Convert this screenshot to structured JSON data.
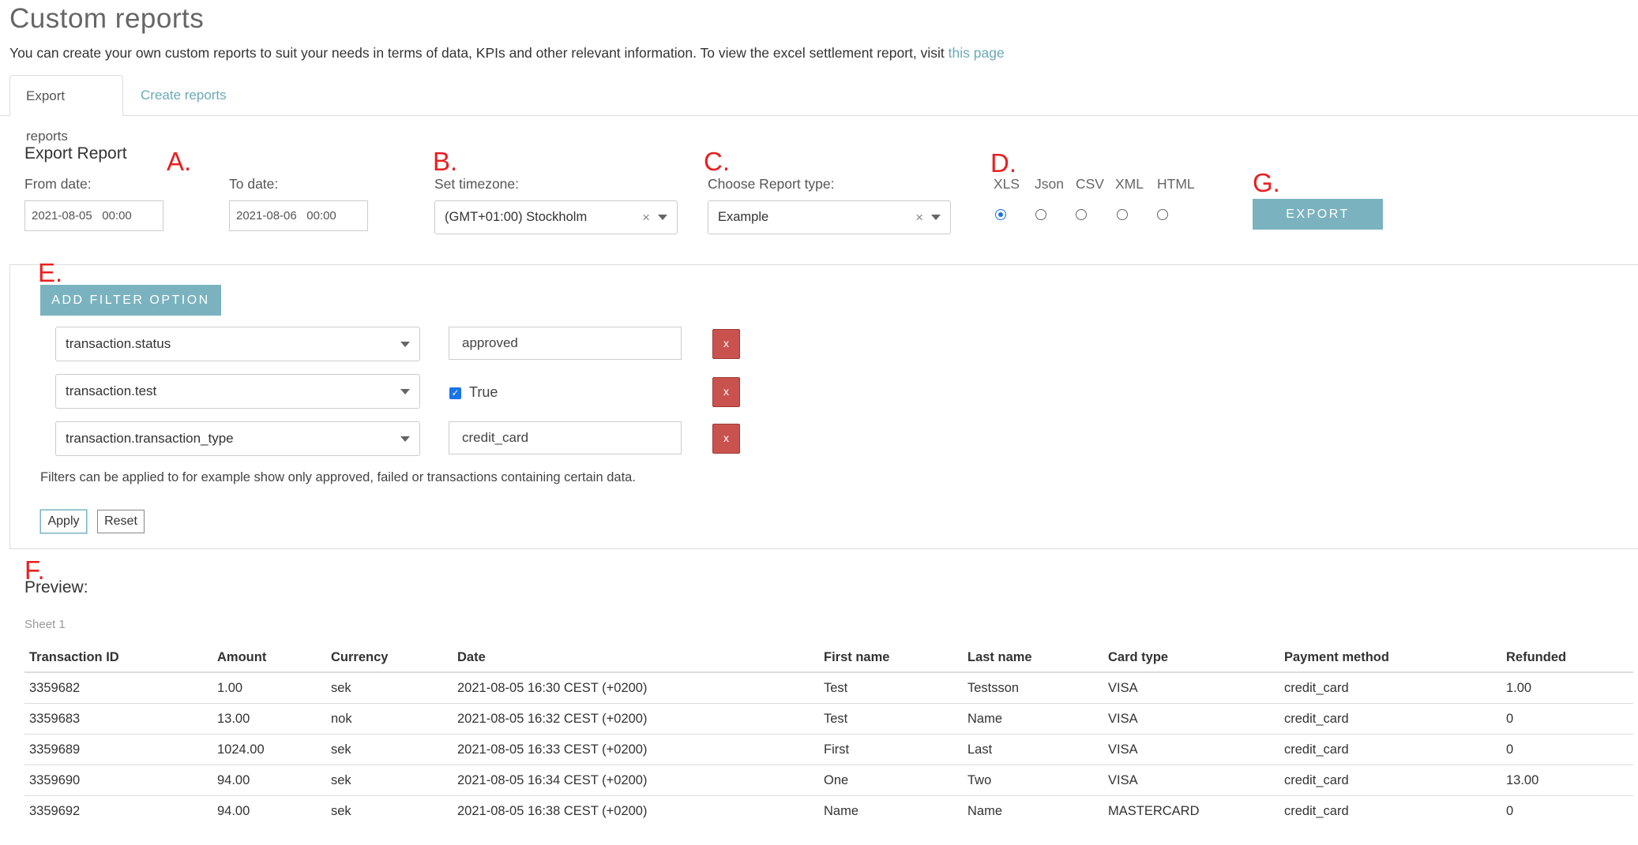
{
  "page": {
    "title": "Custom reports",
    "intro_text": "You can create your own custom reports to suit your needs in terms of data, KPIs and other relevant information. To view the excel settlement report, visit ",
    "intro_link": "this page"
  },
  "tabs": [
    {
      "label": "Export reports",
      "active": true
    },
    {
      "label": "Create reports",
      "active": false
    }
  ],
  "annotations": {
    "a": "A.",
    "b": "B.",
    "c": "C.",
    "d": "D.",
    "e": "E.",
    "f": "F.",
    "g": "G."
  },
  "export": {
    "title": "Export Report",
    "from_label": "From date:",
    "from_value": "2021-08-05   00:00",
    "to_label": "To date:",
    "to_value": "2021-08-06   00:00",
    "timezone_label": "Set timezone:",
    "timezone_value": "(GMT+01:00) Stockholm",
    "report_type_label": "Choose Report type:",
    "report_type_value": "Example",
    "clear_glyph": "×",
    "formats": [
      {
        "label": "XLS",
        "selected": true
      },
      {
        "label": "Json",
        "selected": false
      },
      {
        "label": "CSV",
        "selected": false
      },
      {
        "label": "XML",
        "selected": false
      },
      {
        "label": "HTML",
        "selected": false
      }
    ],
    "export_button": "EXPORT"
  },
  "filters": {
    "add_button": "ADD FILTER OPTION",
    "rows": [
      {
        "field": "transaction.status",
        "value": "approved",
        "type": "text"
      },
      {
        "field": "transaction.test",
        "value": "True",
        "type": "checkbox",
        "checked": true
      },
      {
        "field": "transaction.transaction_type",
        "value": "credit_card",
        "type": "text"
      }
    ],
    "remove_label": "x",
    "help_text": "Filters can be applied to for example show only approved, failed or transactions containing certain data.",
    "apply_button": "Apply",
    "reset_button": "Reset"
  },
  "preview": {
    "title": "Preview:",
    "sheet_name": "Sheet 1",
    "columns": [
      "Transaction ID",
      "Amount",
      "Currency",
      "Date",
      "First name",
      "Last name",
      "Card type",
      "Payment method",
      "Refunded"
    ],
    "rows": [
      [
        "3359682",
        "1.00",
        "sek",
        "2021-08-05 16:30 CEST (+0200)",
        "Test",
        "Testsson",
        "VISA",
        "credit_card",
        "1.00"
      ],
      [
        "3359683",
        "13.00",
        "nok",
        "2021-08-05 16:32 CEST (+0200)",
        "Test",
        "Name",
        "VISA",
        "credit_card",
        "0"
      ],
      [
        "3359689",
        "1024.00",
        "sek",
        "2021-08-05 16:33 CEST (+0200)",
        "First",
        "Last",
        "VISA",
        "credit_card",
        "0"
      ],
      [
        "3359690",
        "94.00",
        "sek",
        "2021-08-05 16:34 CEST (+0200)",
        "One",
        "Two",
        "VISA",
        "credit_card",
        "13.00"
      ],
      [
        "3359692",
        "94.00",
        "sek",
        "2021-08-05 16:38 CEST (+0200)",
        "Name",
        "Name",
        "MASTERCARD",
        "credit_card",
        "0"
      ]
    ]
  },
  "colors": {
    "accent": "#7ab3bf",
    "link": "#6aaab8",
    "danger": "#c9524f",
    "annotation": "#e82020",
    "radio_selected": "#1a73e8"
  }
}
